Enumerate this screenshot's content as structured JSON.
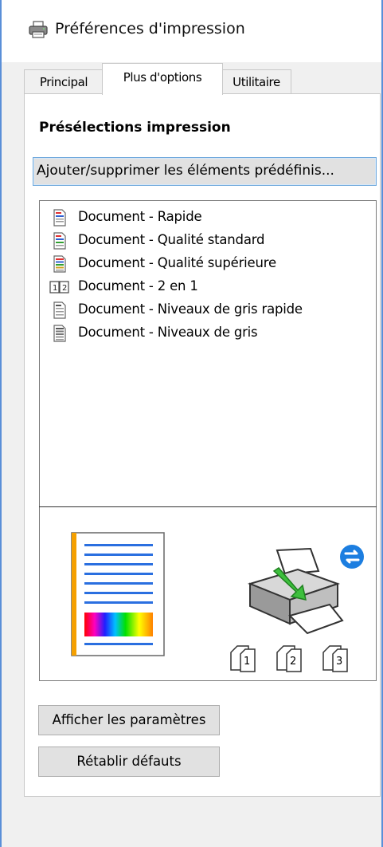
{
  "window": {
    "title": "Préférences d'impression",
    "icon": "printer-icon"
  },
  "tabs": [
    {
      "label": "Principal",
      "selected": false
    },
    {
      "label": "Plus d'options",
      "selected": true
    },
    {
      "label": "Utilitaire",
      "selected": false
    }
  ],
  "presets": {
    "heading": "Présélections impression",
    "add_remove_label": "Ajouter/supprimer les éléments prédéfinis...",
    "items": [
      {
        "label": "Document - Rapide",
        "icon": "document-color-fast-icon"
      },
      {
        "label": "Document - Qualité standard",
        "icon": "document-color-standard-icon"
      },
      {
        "label": "Document - Qualité supérieure",
        "icon": "document-color-high-icon"
      },
      {
        "label": "Document - 2 en 1",
        "icon": "two-up-icon"
      },
      {
        "label": "Document - Niveaux de gris rapide",
        "icon": "document-grayscale-fast-icon"
      },
      {
        "label": "Document - Niveaux de gris",
        "icon": "document-grayscale-icon"
      }
    ]
  },
  "preview": {
    "page_icon": "page-preview-icon",
    "printer_icon": "printer-paper-feed-icon",
    "sync_icon": "two-way-arrows-icon",
    "collate_pages": [
      "1",
      "2",
      "3"
    ]
  },
  "buttons": {
    "show_settings": "Afficher les paramètres",
    "restore_defaults": "Rétablir défauts"
  },
  "colors": {
    "window_border": "#5a8fd8",
    "focus_border": "#6fa8dc",
    "preview_orange": "#f5a000",
    "preview_blue": "#2a6fe0",
    "sync_badge": "#1c7ee0"
  }
}
